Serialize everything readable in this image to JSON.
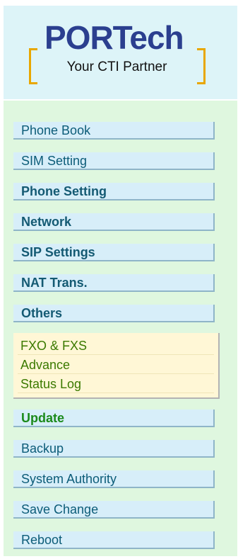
{
  "logo": {
    "brand": "PORTech",
    "tagline": "Your CTI Partner",
    "colors": {
      "brand": "#2b3f8f",
      "bracket": "#e8a700"
    }
  },
  "menu": {
    "items": [
      {
        "label": "Phone Book"
      },
      {
        "label": "SIM Setting"
      },
      {
        "label": "Phone Setting"
      },
      {
        "label": "Network"
      },
      {
        "label": "SIP Settings"
      },
      {
        "label": "NAT Trans."
      },
      {
        "label": "Others"
      }
    ],
    "others_submenu": [
      {
        "label": "FXO & FXS"
      },
      {
        "label": "Advance"
      },
      {
        "label": "Status Log"
      }
    ],
    "items_after": [
      {
        "label": "Update"
      },
      {
        "label": "Backup"
      },
      {
        "label": "System Authority"
      },
      {
        "label": "Save Change"
      },
      {
        "label": "Reboot"
      }
    ]
  },
  "colors": {
    "header_bg": "#ddf4f8",
    "menu_bg": "#dff7df",
    "item_bg": "#d7eef9",
    "submenu_bg": "#fff7d6",
    "item_text": "#0c5c78",
    "update_text": "#1b8a1b",
    "submenu_text": "#3b7a00"
  }
}
